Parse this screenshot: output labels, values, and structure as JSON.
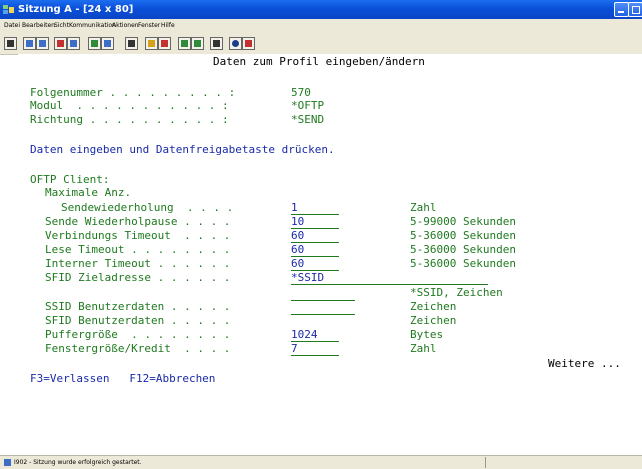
{
  "window": {
    "title": "Sitzung A - [24 x 80]"
  },
  "menu": [
    "Datei",
    "Bearbeiten",
    "Sicht",
    "Kommunikation",
    "Aktionen",
    "Fenster",
    "Hilfe"
  ],
  "screen": {
    "header": "Daten zum Profil eingeben/ändern",
    "folgenummer_label": "Folgenummer . . . . . . . . . :",
    "folgenummer_value": "570",
    "modul_label": "Modul  . . . . . . . . . . . :",
    "modul_value": "*OFTP",
    "richtung_label": "Richtung . . . . . . . . . . :",
    "richtung_value": "*SEND",
    "instruction": "Daten eingeben und Datenfreigabetaste drücken.",
    "section": "OFTP Client:",
    "subsection": "Maximale Anz.",
    "fields": [
      {
        "label": "Sendewiederholung  . . . .",
        "value": "1",
        "hint": "Zahl"
      },
      {
        "label": "Sende Wiederholpause . . . .",
        "value": "10",
        "hint": "5-99000 Sekunden"
      },
      {
        "label": "Verbindungs Timeout  . . . .",
        "value": "60",
        "hint": "5-36000 Sekunden"
      },
      {
        "label": "Lese Timeout . . . . . . . .",
        "value": "60",
        "hint": "5-36000 Sekunden"
      },
      {
        "label": "Interner Timeout . . . . . .",
        "value": "60",
        "hint": "5-36000 Sekunden"
      },
      {
        "label": "SFID Zieladresse . . . . . .",
        "value": "*SSID",
        "hint": "*SSID, Zeichen"
      },
      {
        "label": "SSID Benutzerdaten . . . . .",
        "value": "",
        "hint": "Zeichen"
      },
      {
        "label": "SFID Benutzerdaten . . . . .",
        "value": "",
        "hint": "Zeichen"
      },
      {
        "label": "Puffergröße  . . . . . . . .",
        "value": "1024",
        "hint": "Bytes"
      },
      {
        "label": "Fenstergröße/Kredit  . . . .",
        "value": "7",
        "hint": "Zahl"
      }
    ],
    "more": "Weitere ...",
    "fkeys": "F3=Verlassen   F12=Abbrechen"
  },
  "status": {
    "text": "I902 - Sitzung wurde erfolgreich gestartet."
  }
}
